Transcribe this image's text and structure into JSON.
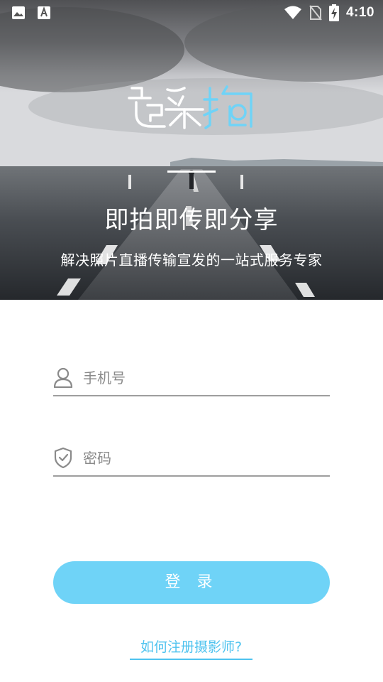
{
  "status_bar": {
    "time": "4:10",
    "left_icons": [
      "gallery-notification-icon",
      "font-notification-icon"
    ],
    "right_icons": [
      "wifi-icon",
      "no-sim-icon",
      "battery-charging-icon"
    ]
  },
  "hero": {
    "logo_icon": "qicaipai-logo",
    "tagline": "即拍即传即分享",
    "subtitle": "解决照片直播传输宣发的一站式服务专家"
  },
  "form": {
    "phone": {
      "placeholder": "手机号",
      "value": "",
      "icon": "user-icon"
    },
    "password": {
      "placeholder": "密码",
      "value": "",
      "icon": "shield-check-icon"
    },
    "login_label": "登 录",
    "register_link": "如何注册摄影师?"
  },
  "colors": {
    "accent": "#6fd3f7",
    "link": "#4fc3ef",
    "field_line": "#9e9e9e"
  }
}
